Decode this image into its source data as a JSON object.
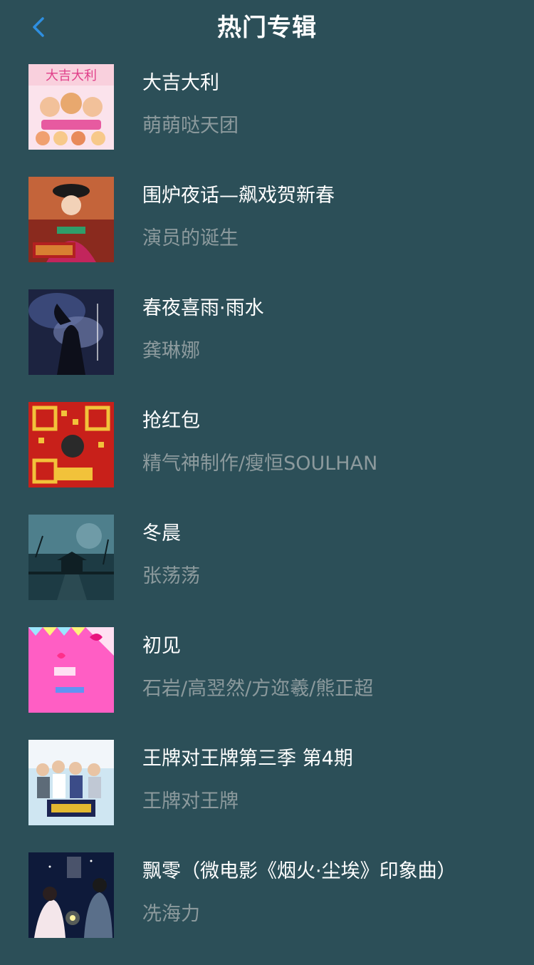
{
  "header": {
    "title": "热门专辑",
    "back_icon": "chevron-left-icon",
    "accent_color": "#2e8fe0"
  },
  "colors": {
    "background": "#2c4f58",
    "title_text": "#ffffff",
    "artist_text": "#8c9a9d"
  },
  "albums": [
    {
      "title": "大吉大利",
      "artist": "萌萌哒天团"
    },
    {
      "title": "围炉夜话—飙戏贺新春",
      "artist": "演员的诞生"
    },
    {
      "title": "春夜喜雨·雨水",
      "artist": "龚琳娜"
    },
    {
      "title": "抢红包",
      "artist": "精气神制作/瘦恒SOULHAN"
    },
    {
      "title": "冬晨",
      "artist": "张荡荡"
    },
    {
      "title": "初见",
      "artist": "石岩/高翌然/方迩羲/熊正超"
    },
    {
      "title": "王牌对王牌第三季 第4期",
      "artist": "王牌对王牌"
    },
    {
      "title": "飘零（微电影《烟火·尘埃》印象曲）",
      "artist": "冼海力"
    }
  ]
}
